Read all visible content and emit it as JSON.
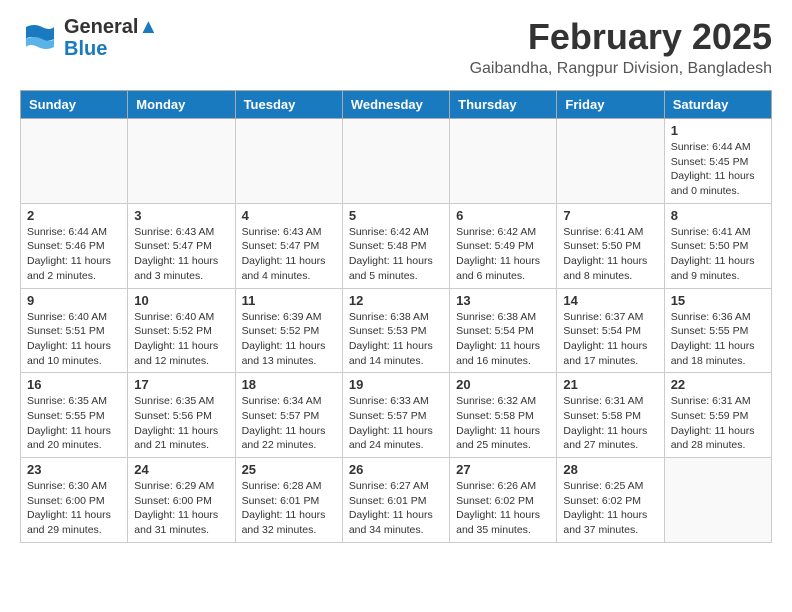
{
  "header": {
    "logo_general": "General",
    "logo_blue": "Blue",
    "month_title": "February 2025",
    "location": "Gaibandha, Rangpur Division, Bangladesh"
  },
  "days_of_week": [
    "Sunday",
    "Monday",
    "Tuesday",
    "Wednesday",
    "Thursday",
    "Friday",
    "Saturday"
  ],
  "weeks": [
    [
      {
        "day": "",
        "info": ""
      },
      {
        "day": "",
        "info": ""
      },
      {
        "day": "",
        "info": ""
      },
      {
        "day": "",
        "info": ""
      },
      {
        "day": "",
        "info": ""
      },
      {
        "day": "",
        "info": ""
      },
      {
        "day": "1",
        "info": "Sunrise: 6:44 AM\nSunset: 5:45 PM\nDaylight: 11 hours\nand 0 minutes."
      }
    ],
    [
      {
        "day": "2",
        "info": "Sunrise: 6:44 AM\nSunset: 5:46 PM\nDaylight: 11 hours\nand 2 minutes."
      },
      {
        "day": "3",
        "info": "Sunrise: 6:43 AM\nSunset: 5:47 PM\nDaylight: 11 hours\nand 3 minutes."
      },
      {
        "day": "4",
        "info": "Sunrise: 6:43 AM\nSunset: 5:47 PM\nDaylight: 11 hours\nand 4 minutes."
      },
      {
        "day": "5",
        "info": "Sunrise: 6:42 AM\nSunset: 5:48 PM\nDaylight: 11 hours\nand 5 minutes."
      },
      {
        "day": "6",
        "info": "Sunrise: 6:42 AM\nSunset: 5:49 PM\nDaylight: 11 hours\nand 6 minutes."
      },
      {
        "day": "7",
        "info": "Sunrise: 6:41 AM\nSunset: 5:50 PM\nDaylight: 11 hours\nand 8 minutes."
      },
      {
        "day": "8",
        "info": "Sunrise: 6:41 AM\nSunset: 5:50 PM\nDaylight: 11 hours\nand 9 minutes."
      }
    ],
    [
      {
        "day": "9",
        "info": "Sunrise: 6:40 AM\nSunset: 5:51 PM\nDaylight: 11 hours\nand 10 minutes."
      },
      {
        "day": "10",
        "info": "Sunrise: 6:40 AM\nSunset: 5:52 PM\nDaylight: 11 hours\nand 12 minutes."
      },
      {
        "day": "11",
        "info": "Sunrise: 6:39 AM\nSunset: 5:52 PM\nDaylight: 11 hours\nand 13 minutes."
      },
      {
        "day": "12",
        "info": "Sunrise: 6:38 AM\nSunset: 5:53 PM\nDaylight: 11 hours\nand 14 minutes."
      },
      {
        "day": "13",
        "info": "Sunrise: 6:38 AM\nSunset: 5:54 PM\nDaylight: 11 hours\nand 16 minutes."
      },
      {
        "day": "14",
        "info": "Sunrise: 6:37 AM\nSunset: 5:54 PM\nDaylight: 11 hours\nand 17 minutes."
      },
      {
        "day": "15",
        "info": "Sunrise: 6:36 AM\nSunset: 5:55 PM\nDaylight: 11 hours\nand 18 minutes."
      }
    ],
    [
      {
        "day": "16",
        "info": "Sunrise: 6:35 AM\nSunset: 5:55 PM\nDaylight: 11 hours\nand 20 minutes."
      },
      {
        "day": "17",
        "info": "Sunrise: 6:35 AM\nSunset: 5:56 PM\nDaylight: 11 hours\nand 21 minutes."
      },
      {
        "day": "18",
        "info": "Sunrise: 6:34 AM\nSunset: 5:57 PM\nDaylight: 11 hours\nand 22 minutes."
      },
      {
        "day": "19",
        "info": "Sunrise: 6:33 AM\nSunset: 5:57 PM\nDaylight: 11 hours\nand 24 minutes."
      },
      {
        "day": "20",
        "info": "Sunrise: 6:32 AM\nSunset: 5:58 PM\nDaylight: 11 hours\nand 25 minutes."
      },
      {
        "day": "21",
        "info": "Sunrise: 6:31 AM\nSunset: 5:58 PM\nDaylight: 11 hours\nand 27 minutes."
      },
      {
        "day": "22",
        "info": "Sunrise: 6:31 AM\nSunset: 5:59 PM\nDaylight: 11 hours\nand 28 minutes."
      }
    ],
    [
      {
        "day": "23",
        "info": "Sunrise: 6:30 AM\nSunset: 6:00 PM\nDaylight: 11 hours\nand 29 minutes."
      },
      {
        "day": "24",
        "info": "Sunrise: 6:29 AM\nSunset: 6:00 PM\nDaylight: 11 hours\nand 31 minutes."
      },
      {
        "day": "25",
        "info": "Sunrise: 6:28 AM\nSunset: 6:01 PM\nDaylight: 11 hours\nand 32 minutes."
      },
      {
        "day": "26",
        "info": "Sunrise: 6:27 AM\nSunset: 6:01 PM\nDaylight: 11 hours\nand 34 minutes."
      },
      {
        "day": "27",
        "info": "Sunrise: 6:26 AM\nSunset: 6:02 PM\nDaylight: 11 hours\nand 35 minutes."
      },
      {
        "day": "28",
        "info": "Sunrise: 6:25 AM\nSunset: 6:02 PM\nDaylight: 11 hours\nand 37 minutes."
      },
      {
        "day": "",
        "info": ""
      }
    ]
  ]
}
